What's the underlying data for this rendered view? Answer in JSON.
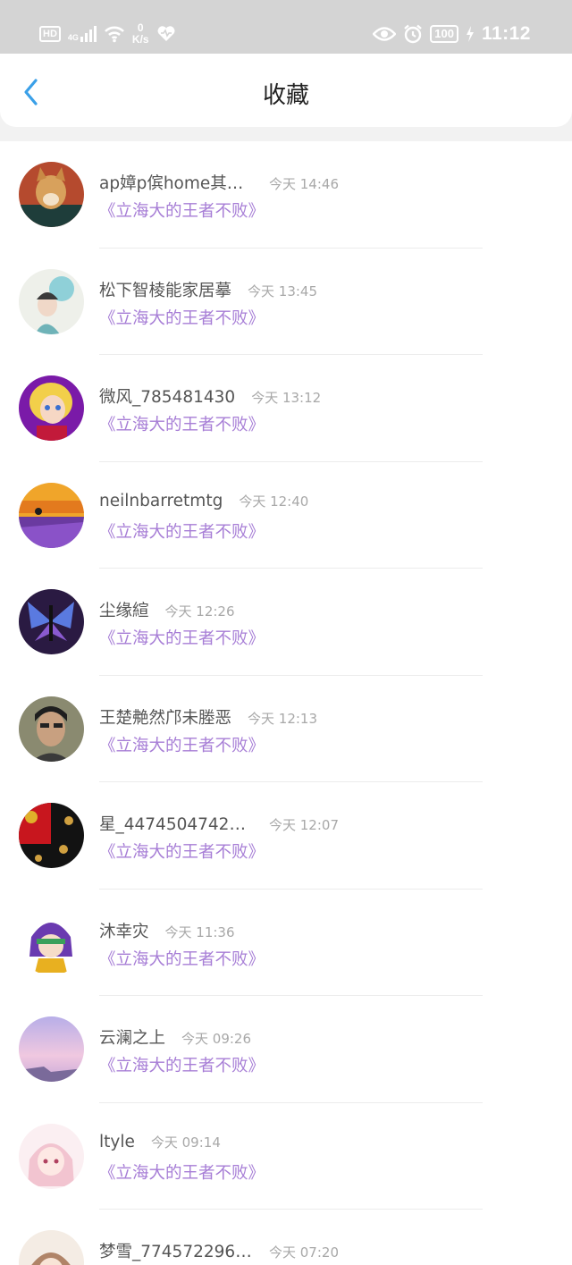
{
  "status_bar": {
    "hd": "HD",
    "network": "4G",
    "speed_value": "0",
    "speed_unit": "K/s",
    "battery": "100",
    "time": "11:12",
    "icons": [
      "hd-icon",
      "signal-icon",
      "wifi-icon",
      "heart-icon",
      "eye-icon",
      "alarm-icon",
      "battery-icon",
      "charging-icon"
    ]
  },
  "header": {
    "title": "收藏",
    "back_icon": "chevron-left-icon",
    "accent_color": "#3aa0e8"
  },
  "colors": {
    "username": "#555555",
    "time": "#a8a8a8",
    "book_title": "#a77ed6"
  },
  "favorites": [
    {
      "user": "ap嫜p傧home其他...",
      "time": "今天 14:46",
      "book": "《立海大的王者不败》"
    },
    {
      "user": "松下智棱能家居摹",
      "time": "今天 13:45",
      "book": "《立海大的王者不败》"
    },
    {
      "user": "微风_785481430",
      "time": "今天 13:12",
      "book": "《立海大的王者不败》"
    },
    {
      "user": "neilnbarretmtg",
      "time": "今天 12:40",
      "book": "《立海大的王者不败》"
    },
    {
      "user": "尘缘縇",
      "time": "今天 12:26",
      "book": "《立海大的王者不败》"
    },
    {
      "user": "王楚艴然邝未塍恶",
      "time": "今天 12:13",
      "book": "《立海大的王者不败》"
    },
    {
      "user": "星_447450474256...",
      "time": "今天 12:07",
      "book": "《立海大的王者不败》"
    },
    {
      "user": "沐幸灾",
      "time": "今天 11:36",
      "book": "《立海大的王者不败》"
    },
    {
      "user": "云澜之上",
      "time": "今天 09:26",
      "book": "《立海大的王者不败》"
    },
    {
      "user": "ltyle",
      "time": "今天 09:14",
      "book": "《立海大的王者不败》"
    },
    {
      "user": "梦雪_7745722966...",
      "time": "今天 07:20",
      "book": ""
    }
  ]
}
